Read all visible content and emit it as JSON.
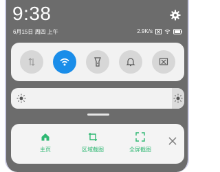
{
  "status_bar": {
    "time": "9:38",
    "date": "6月15日 周四 上午",
    "network_speed": "2.9K/s",
    "icons": [
      "sim-x-icon",
      "wifi-icon",
      "battery-icon"
    ]
  },
  "toggles": [
    {
      "name": "mobile-data",
      "icon": "arrows-updown-icon",
      "active": false
    },
    {
      "name": "wifi",
      "icon": "wifi-icon",
      "active": true
    },
    {
      "name": "flashlight",
      "icon": "flashlight-icon",
      "active": false
    },
    {
      "name": "notifications",
      "icon": "bell-icon",
      "active": false
    },
    {
      "name": "screenshot",
      "icon": "screenshot-icon",
      "active": false
    }
  ],
  "brightness": {
    "level": 0.0
  },
  "screenshot_card": {
    "actions": [
      {
        "label": "主页",
        "icon": "home-icon"
      },
      {
        "label": "区域截图",
        "icon": "crop-icon"
      },
      {
        "label": "全屏截图",
        "icon": "fullscreen-icon"
      }
    ]
  },
  "colors": {
    "accent": "#1a8de9",
    "action_green": "#2fb873"
  }
}
